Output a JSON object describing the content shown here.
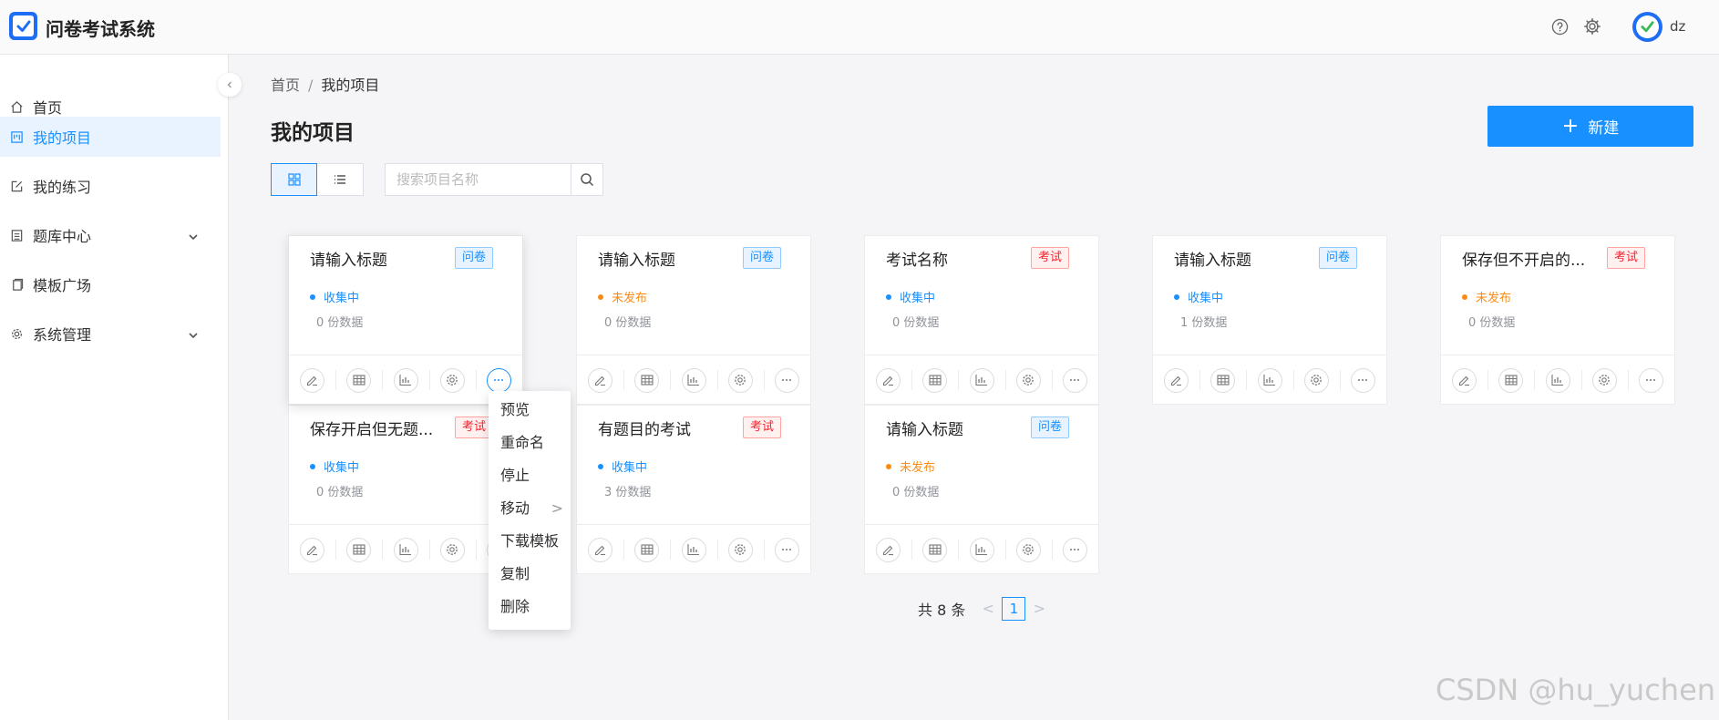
{
  "app": {
    "title": "问卷考试系统",
    "user": "dz"
  },
  "colors": {
    "primary": "#1890ff",
    "brand": "#1e6ef4",
    "warning": "#fa8c16",
    "danger": "#f5222d"
  },
  "header_icons": [
    "help-circle-icon",
    "gear-icon"
  ],
  "sidebar": {
    "items": [
      {
        "label": "首页",
        "icon": "home-icon"
      },
      {
        "label": "我的项目",
        "icon": "project-icon",
        "active": true
      },
      {
        "label": "我的练习",
        "icon": "edit-icon"
      },
      {
        "label": "题库中心",
        "icon": "list-icon",
        "expandable": true
      },
      {
        "label": "模板广场",
        "icon": "copy-icon"
      },
      {
        "label": "系统管理",
        "icon": "gear-icon",
        "expandable": true
      }
    ]
  },
  "breadcrumb": {
    "home": "首页",
    "sep": "/",
    "current": "我的项目"
  },
  "page": {
    "title": "我的项目",
    "new_plus": "+",
    "new_label": "新建"
  },
  "search": {
    "placeholder": "搜索项目名称",
    "value": ""
  },
  "cards": [
    {
      "title": "请输入标题",
      "tag": "问卷",
      "status": "收集中",
      "count": "0 份数据"
    },
    {
      "title": "请输入标题",
      "tag": "问卷",
      "status": "未发布",
      "count": "0 份数据"
    },
    {
      "title": "考试名称",
      "tag": "考试",
      "status": "收集中",
      "count": "0 份数据"
    },
    {
      "title": "请输入标题",
      "tag": "问卷",
      "status": "收集中",
      "count": "1 份数据"
    },
    {
      "title": "保存但不开启的...",
      "tag": "考试",
      "status": "未发布",
      "count": "0 份数据"
    },
    {
      "title": "保存开启但无题...",
      "tag": "考试",
      "status": "收集中",
      "count": "0 份数据"
    },
    {
      "title": "有题目的考试",
      "tag": "考试",
      "status": "收集中",
      "count": "3 份数据"
    },
    {
      "title": "请输入标题",
      "tag": "问卷",
      "status": "未发布",
      "count": "0 份数据"
    }
  ],
  "card_actions": [
    "edit-icon",
    "table-icon",
    "chart-icon",
    "gear-icon",
    "more-icon"
  ],
  "dropdown": {
    "items": [
      {
        "label": "预览"
      },
      {
        "label": "重命名"
      },
      {
        "label": "停止"
      },
      {
        "label": "移动",
        "submenu": ">"
      },
      {
        "label": "下载模板"
      },
      {
        "label": "复制"
      },
      {
        "label": "删除"
      }
    ]
  },
  "pagination": {
    "total": "共 8 条",
    "current": "1",
    "prev": "<",
    "next": ">"
  },
  "watermark": "CSDN @hu_yuchen"
}
